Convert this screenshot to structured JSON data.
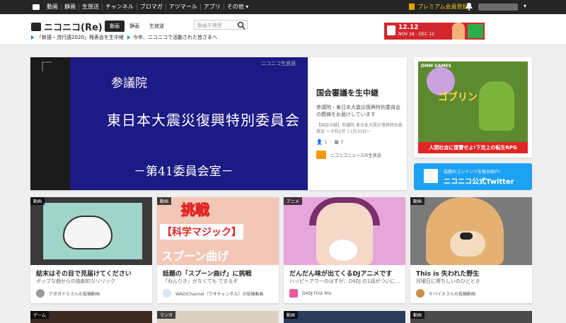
{
  "topbar": {
    "nav": [
      "動画",
      "静画",
      "生放送",
      "チャンネル",
      "ブロマガ",
      "アツマール",
      "アプリ",
      "その他 ▾"
    ],
    "premium_label": "プレミアム会員登録",
    "user_caret": "▾"
  },
  "header": {
    "logo_text": "ニコニコ(Re)",
    "tabs": [
      "動画",
      "静画",
      "生放送"
    ],
    "search_placeholder": "動画を検索",
    "ad_banner": {
      "line1": "12.12",
      "line2": "NOV 18 - DEC 12"
    },
    "news": [
      "「新語・流行語2020」発表会を生中継",
      "今年、ニコニコで活動された皆さまへ"
    ]
  },
  "feature": {
    "video_logo": "ニコニコ生放送",
    "screen_line1": "参議院",
    "screen_line2": "東日本大震災復興特別委員会",
    "screen_line3": "－第41委員会室－",
    "title": "国会審議を生中継",
    "description": "参議院・東日本大震災復興特別委員会の模様をお届けしています",
    "sub": "【国会中継】参議院 東日本大震災復興特別委員会 〜令和2年 11月30日〜",
    "views": "1",
    "comments": "0",
    "channel": "ニコニコニュースの生放送"
  },
  "side_ad": {
    "brand": "DMM GAMES",
    "big_text": "ゴブリン",
    "bottom": "人間社会に復讐せよ!下克上の転生RPG"
  },
  "twitter": {
    "line1": "話題のコンテンツを毎日紹介!",
    "line2": "ニコニコ公式Twitter"
  },
  "cards": [
    {
      "badge": "動画",
      "title": "結末はその目で見届けてください",
      "desc": "ポップな曲からの独創的なリリック",
      "user": "アボガドらさんの投稿動画"
    },
    {
      "badge": "動画",
      "title": "話題の「スプーン曲げ」に挑戦",
      "desc": "「ねんりき」がなくても できるぞ",
      "user": "WAOIChannel（ワオチャンネル）の投稿動画",
      "thumb_text": [
        "挑戦",
        "【科学マジック】",
        "スプーン曲げ"
      ]
    },
    {
      "badge": "アニメ",
      "title": "だんだん味が出てくるDJアニメです",
      "desc": "ハッピーアワーのはずが、D4DJ の1話がついに…",
      "user": "D4DJ First Mix"
    },
    {
      "badge": "動画",
      "title": "This is 失われた野生",
      "desc": "月曜日に寄ちしいのひととき",
      "user": "キバイヌさんの投稿動画"
    }
  ],
  "bottom_badges": [
    "ゲーム",
    "マンガ",
    "動画",
    "動画"
  ]
}
